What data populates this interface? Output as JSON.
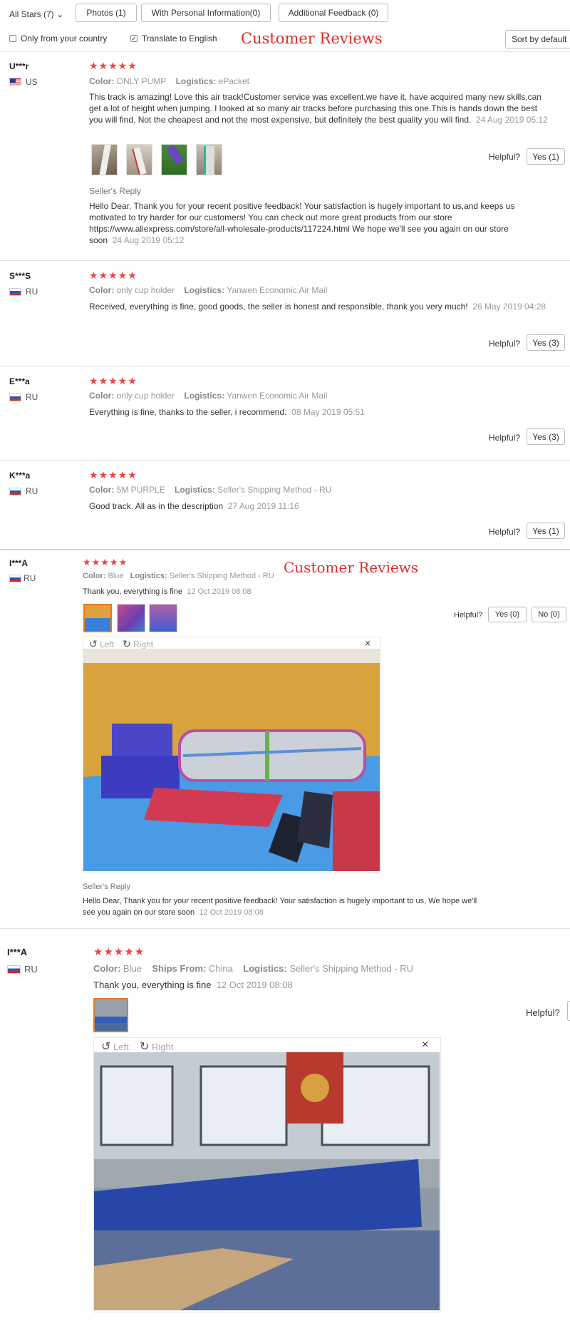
{
  "filters": {
    "all_stars": "All Stars (7)",
    "photos": "Photos (1)",
    "personal": "With Personal Information(0)",
    "additional": "Additional Feedback (0)",
    "only_country": "Only from your country",
    "translate": "Translate to English",
    "sort": "Sort by default"
  },
  "overlay_title": "Customer Reviews",
  "stars": "★★★★★",
  "labels": {
    "color": "Color:",
    "logistics": "Logistics:",
    "ships_from": "Ships From:",
    "helpful": "Helpful?",
    "seller_reply": "Seller's Reply",
    "left": "Left",
    "right": "Right",
    "close": "×"
  },
  "reviews": [
    {
      "name": "U***r",
      "country": "US",
      "color": "ONLY PUMP",
      "logistics": "ePacket",
      "text": "This track is amazing! Love this air track!Customer service was excellent.we have it, have acquired many new skills,can get a lot of height when jumping. I looked at so many air tracks before purchasing this one.This is hands down the best you will find. Not the cheapest and not the most expensive, but definitely the best quality you will find.",
      "date": "24 Aug 2019 05:12",
      "yes": "Yes (1)",
      "reply": "Hello Dear, Thank you for your recent positive feedback! Your satisfaction is hugely important to us,and keeps us motivated to try harder for our customers! You can check out more great products from our store https://www.aliexpress.com/store/all-wholesale-products/117224.html We hope we'll see you again on our store soon",
      "reply_date": "24 Aug 2019 05:12"
    },
    {
      "name": "S***S",
      "country": "RU",
      "color": "only cup holder",
      "logistics": "Yanwen Economic Air Mail",
      "text": "Received, everything is fine, good goods, the seller is honest and responsible, thank you very much!",
      "date": "26 May 2019 04:28",
      "yes": "Yes (3)"
    },
    {
      "name": "E***a",
      "country": "RU",
      "color": "only cup holder",
      "logistics": "Yanwen Economic Air Mail",
      "text": "Everything is fine, thanks to the seller, i recommend.",
      "date": "08 May 2019 05:51",
      "yes": "Yes (3)"
    },
    {
      "name": "K***a",
      "country": "RU",
      "color": "5M PURPLE",
      "logistics": "Seller's Shipping Method - RU",
      "text": "Good track. All as in the description",
      "date": "27 Aug 2019 11:16",
      "yes": "Yes (1)"
    },
    {
      "name": "I***A",
      "country": "RU",
      "color": "Blue",
      "logistics": "Seller's Shipping Method - RU",
      "text": "Thank you, everything is fine",
      "date": "12 Oct 2019 08:08",
      "yes": "Yes (0)",
      "no": "No (0)",
      "reply": "Hello Dear, Thank you for your recent positive feedback! Your satisfaction is hugely important to us, We hope we'll see you again on our store soon",
      "reply_date": "12 Oct 2019 08:08"
    },
    {
      "name": "I***A",
      "country": "RU",
      "color": "Blue",
      "ships_from": "China",
      "logistics": "Seller's Shipping Method - RU",
      "text": "Thank you, everything is fine",
      "date": "12 Oct 2019 08:08"
    }
  ]
}
